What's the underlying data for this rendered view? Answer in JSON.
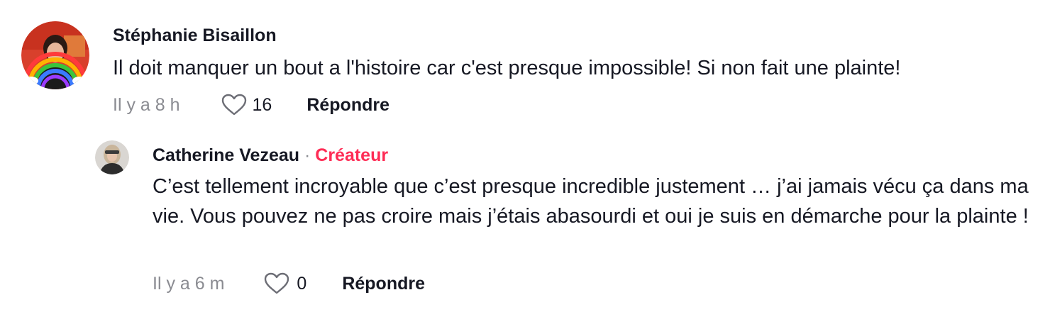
{
  "comments": [
    {
      "author": "Stéphanie Bisaillon",
      "text": "Il doit manquer un bout a l'histoire car c'est presque impossible! Si non fait une plainte!",
      "time": "Il y a 8 h",
      "likes": "16",
      "reply_label": "Répondre",
      "avatar_text": "Va bien aller"
    },
    {
      "author": "Catherine Vezeau",
      "separator": "·",
      "badge": "Créateur",
      "text": "C’est tellement incroyable que c’est presque incredible justement … j’ai jamais vécu ça dans ma vie. Vous pouvez ne pas croire mais j’étais abasourdi et oui je suis en démarche pour la plainte !",
      "time": "Il y a 6 m",
      "likes": "0",
      "reply_label": "Répondre"
    }
  ],
  "colors": {
    "text": "#161823",
    "muted": "#8a8b91",
    "creator": "#fe2c55"
  }
}
